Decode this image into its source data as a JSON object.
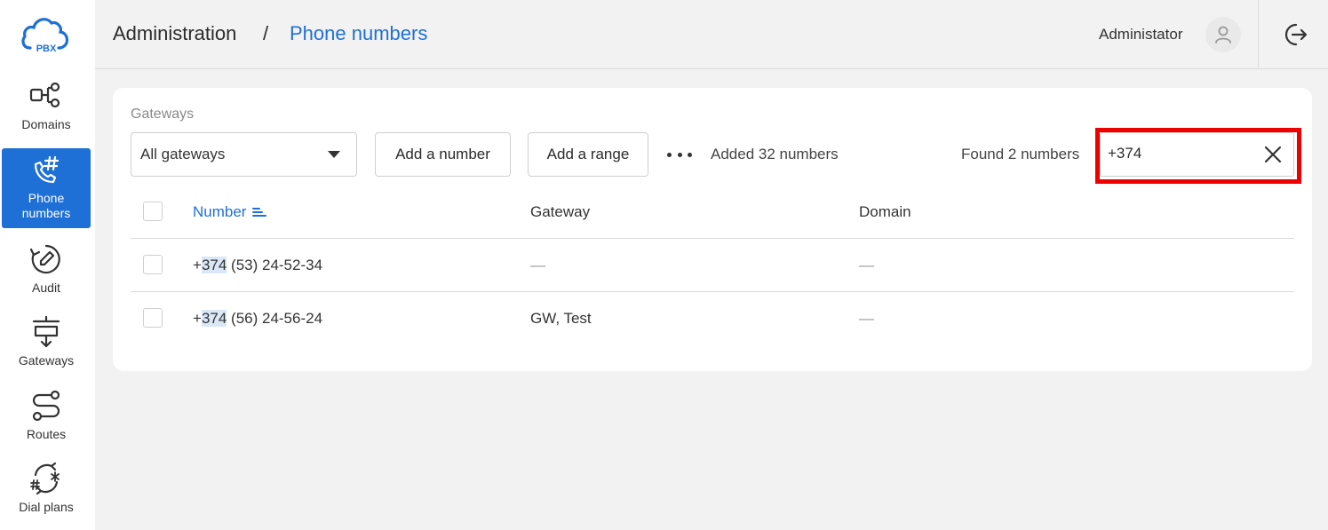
{
  "logo": {
    "text": "PBX"
  },
  "sidebar": {
    "items": [
      {
        "label": "Domains",
        "icon": "domains-icon",
        "active": false
      },
      {
        "label_line1": "Phone",
        "label_line2": "numbers",
        "icon": "phone-hash-icon",
        "active": true
      },
      {
        "label": "Audit",
        "icon": "audit-icon",
        "active": false
      },
      {
        "label": "Gateways",
        "icon": "gateways-icon",
        "active": false
      },
      {
        "label": "Routes",
        "icon": "routes-icon",
        "active": false
      },
      {
        "label": "Dial plans",
        "icon": "dial-plans-icon",
        "active": false
      }
    ]
  },
  "header": {
    "breadcrumb_root": "Administration",
    "breadcrumb_separator": "/",
    "breadcrumb_current": "Phone numbers",
    "user_name": "Administator"
  },
  "toolbar": {
    "gateways_label": "Gateways",
    "gateway_selected": "All gateways",
    "add_number_label": "Add a number",
    "add_range_label": "Add a range",
    "added_text": "Added 32 numbers",
    "found_text": "Found 2 numbers",
    "search_value": "+374"
  },
  "table": {
    "columns": [
      "Number",
      "Gateway",
      "Domain"
    ],
    "rows": [
      {
        "number_prefix": "+",
        "number_match": "374",
        "number_rest": " (53) 24-52-34",
        "gateway": "—",
        "domain": "—"
      },
      {
        "number_prefix": "+",
        "number_match": "374",
        "number_rest": " (56) 24-56-24",
        "gateway": "GW, Test",
        "domain": "—"
      }
    ]
  },
  "colors": {
    "accent": "#1f70d6",
    "highlight_border": "#ee0000",
    "match_highlight": "#d9e7f7",
    "background": "#f2f2f2"
  }
}
